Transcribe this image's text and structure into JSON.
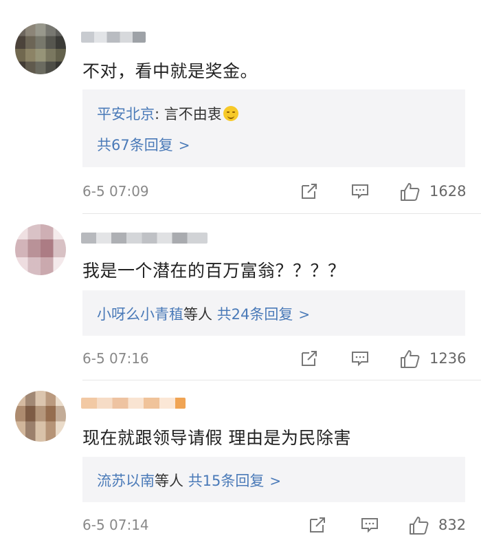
{
  "comments": [
    {
      "text": "不对，看中就是奖金。",
      "reply": {
        "author": "平安北京",
        "sep": ":",
        "content": " 言不由衷",
        "count_label": "共67条回复"
      },
      "time": "6-5 07:09",
      "likes": "1628"
    },
    {
      "text": "我是一个潜在的百万富翁？？？？",
      "reply": {
        "names": "小呀么小青稙",
        "names_suffix": "等人",
        "count_label": "共24条回复"
      },
      "time": "6-5 07:16",
      "likes": "1236"
    },
    {
      "text": "现在就跟领导请假 理由是为民除害",
      "reply": {
        "names": "流苏以南",
        "names_suffix": "等人",
        "count_label": "共15条回复"
      },
      "time": "6-5 07:14",
      "likes": "832"
    }
  ],
  "icons": {
    "share": "share-icon",
    "comment": "comment-icon",
    "like": "thumbs-up-icon",
    "chevron": "chevron-right-icon",
    "emoji": "smile-emoji-icon"
  },
  "colors": {
    "link": "#4a7ab8",
    "reply_bg": "#f4f4f6",
    "meta": "#888888"
  }
}
